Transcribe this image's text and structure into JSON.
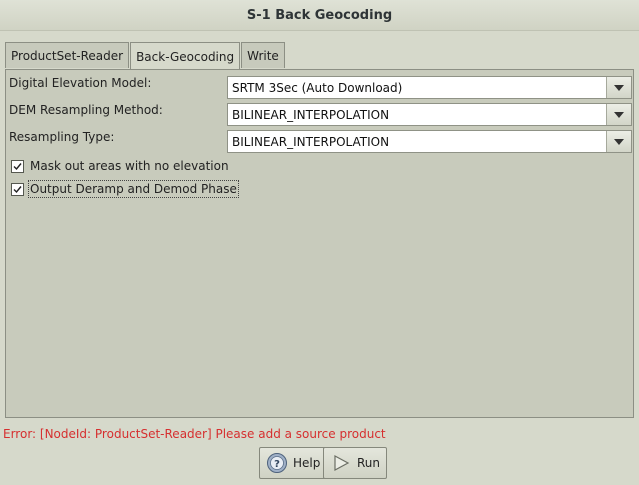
{
  "window": {
    "title": "S-1 Back Geocoding"
  },
  "tabs": [
    {
      "label": "ProductSet-Reader",
      "active": false
    },
    {
      "label": "Back-Geocoding",
      "active": true
    },
    {
      "label": "Write",
      "active": false
    }
  ],
  "form": {
    "dem": {
      "label": "Digital Elevation Model:",
      "value": "SRTM 3Sec (Auto Download)"
    },
    "dem_resampling": {
      "label": "DEM Resampling Method:",
      "value": "BILINEAR_INTERPOLATION"
    },
    "resampling_type": {
      "label": "Resampling Type:",
      "value": "BILINEAR_INTERPOLATION"
    },
    "mask_out": {
      "label": "Mask out areas with no elevation",
      "checked": true
    },
    "deramp": {
      "label": "Output Deramp and Demod Phase",
      "checked": true
    }
  },
  "status": {
    "error": "Error: [NodeId: ProductSet-Reader] Please add a source product"
  },
  "buttons": {
    "help": {
      "label": "Help",
      "icon": "help-icon"
    },
    "run": {
      "label": "Run",
      "icon": "play-icon"
    }
  },
  "colors": {
    "error": "#d62f2f",
    "background": "#d6d9cb"
  }
}
